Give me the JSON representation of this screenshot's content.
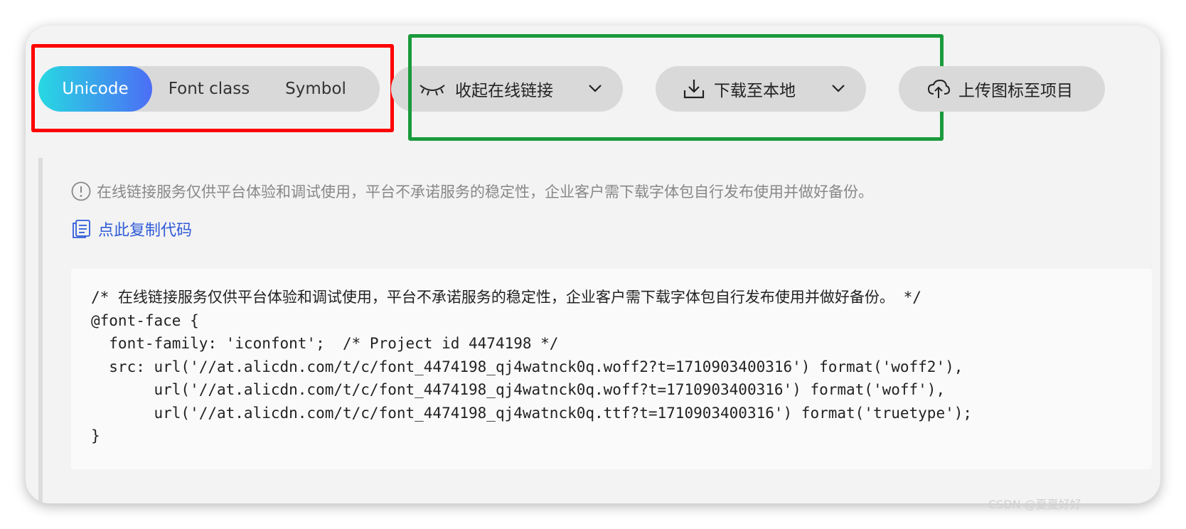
{
  "tabs": [
    {
      "label": "Unicode",
      "active": true
    },
    {
      "label": "Font class",
      "active": false
    },
    {
      "label": "Symbol",
      "active": false
    }
  ],
  "actions": {
    "collapse_link": {
      "label": "收起在线链接",
      "icon": "closed-eye-icon"
    },
    "download": {
      "label": "下载至本地",
      "icon": "download-icon"
    },
    "upload": {
      "label": "上传图标至项目",
      "icon": "cloud-upload-icon"
    }
  },
  "notice": {
    "warning": "在线链接服务仅供平台体验和调试使用，平台不承诺服务的稳定性，企业客户需下载字体包自行发布使用并做好备份。",
    "copy_label": "点此复制代码",
    "code_lines": [
      "/* 在线链接服务仅供平台体验和调试使用，平台不承诺服务的稳定性，企业客户需下载字体包自行发布使用并做好备份。 */",
      "@font-face {",
      "  font-family: 'iconfont';  /* Project id 4474198 */",
      "  src: url('//at.alicdn.com/t/c/font_4474198_qj4watnck0q.woff2?t=1710903400316') format('woff2'),",
      "       url('//at.alicdn.com/t/c/font_4474198_qj4watnck0q.woff?t=1710903400316') format('woff'),",
      "       url('//at.alicdn.com/t/c/font_4474198_qj4watnck0q.ttf?t=1710903400316') format('truetype');",
      "}"
    ]
  },
  "watermark": "CSDN @夏夏好好",
  "colors": {
    "annotation_red": "#ff0000",
    "annotation_green": "#1a9a3c",
    "tab_gradient_start": "#27d9e2",
    "tab_gradient_end": "#4c6ef5",
    "link_blue": "#2f5bd8"
  }
}
